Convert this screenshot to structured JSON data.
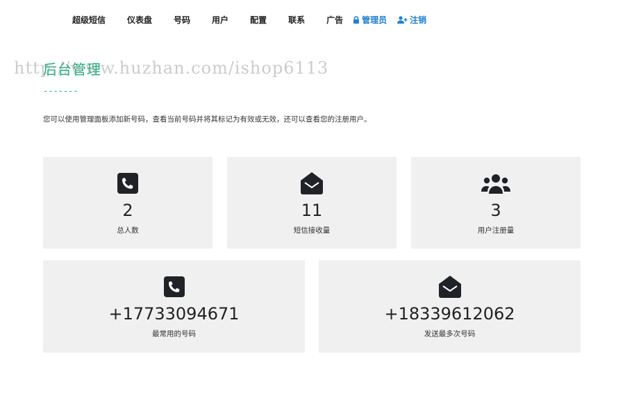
{
  "nav": {
    "items": [
      "超级短信",
      "仪表盘",
      "号码",
      "用户",
      "配置",
      "联系",
      "广告"
    ],
    "admin": "管理员",
    "logout": "注销",
    "icons": {
      "admin": "lock-icon",
      "logout": "user-plus-icon"
    },
    "link_color": "#1f7fd1"
  },
  "header": {
    "title": "后台管理",
    "underline": "-------",
    "accent_color": "#17b07f"
  },
  "watermark": "http://www.huzhan.com/ishop6113",
  "description": "您可以使用管理面板添加新号码，查看当前号码并将其标记为有效或无效，还可以查看您的注册用户。",
  "stats": [
    {
      "icon": "phone-square-icon",
      "value": "2",
      "label": "总人数"
    },
    {
      "icon": "envelope-open-icon",
      "value": "11",
      "label": "短信接收量"
    },
    {
      "icon": "users-icon",
      "value": "3",
      "label": "用户注册量"
    },
    {
      "icon": "phone-square-icon",
      "value": "+17733094671",
      "label": "最常用的号码"
    },
    {
      "icon": "envelope-open-icon",
      "value": "+18339612062",
      "label": "发送最多次号码"
    }
  ]
}
